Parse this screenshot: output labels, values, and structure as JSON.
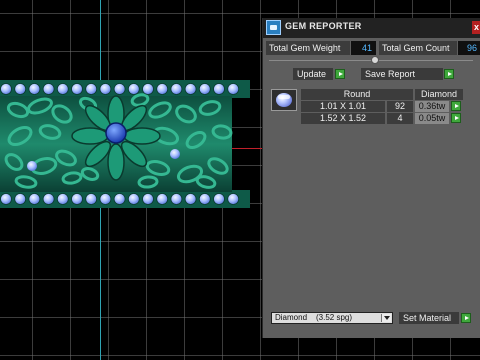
{
  "panel": {
    "title": "GEM REPORTER",
    "total_weight_label": "Total Gem Weight",
    "total_weight_value": "41",
    "total_count_label": "Total Gem Count",
    "total_count_value": "96",
    "slider_value": 0.5,
    "update_label": "Update",
    "save_label": "Save Report",
    "table": {
      "headers": [
        "Round",
        "Diamond"
      ],
      "rows": [
        {
          "size": "1.01 X 1.01",
          "count": "92",
          "weight": "0.36tw"
        },
        {
          "size": "1.52 X 1.52",
          "count": "4",
          "weight": "0.05tw"
        }
      ]
    },
    "material": {
      "name": "Diamond",
      "spg": "(3.52 spg)"
    },
    "set_material_label": "Set Material"
  },
  "colors": {
    "panel_bg": "#5e5e5e",
    "value_text": "#54b8ff",
    "play_green": "#3fa83c",
    "ring_green": "#1f8a6c",
    "gem_blue": "#8fb0ff"
  }
}
